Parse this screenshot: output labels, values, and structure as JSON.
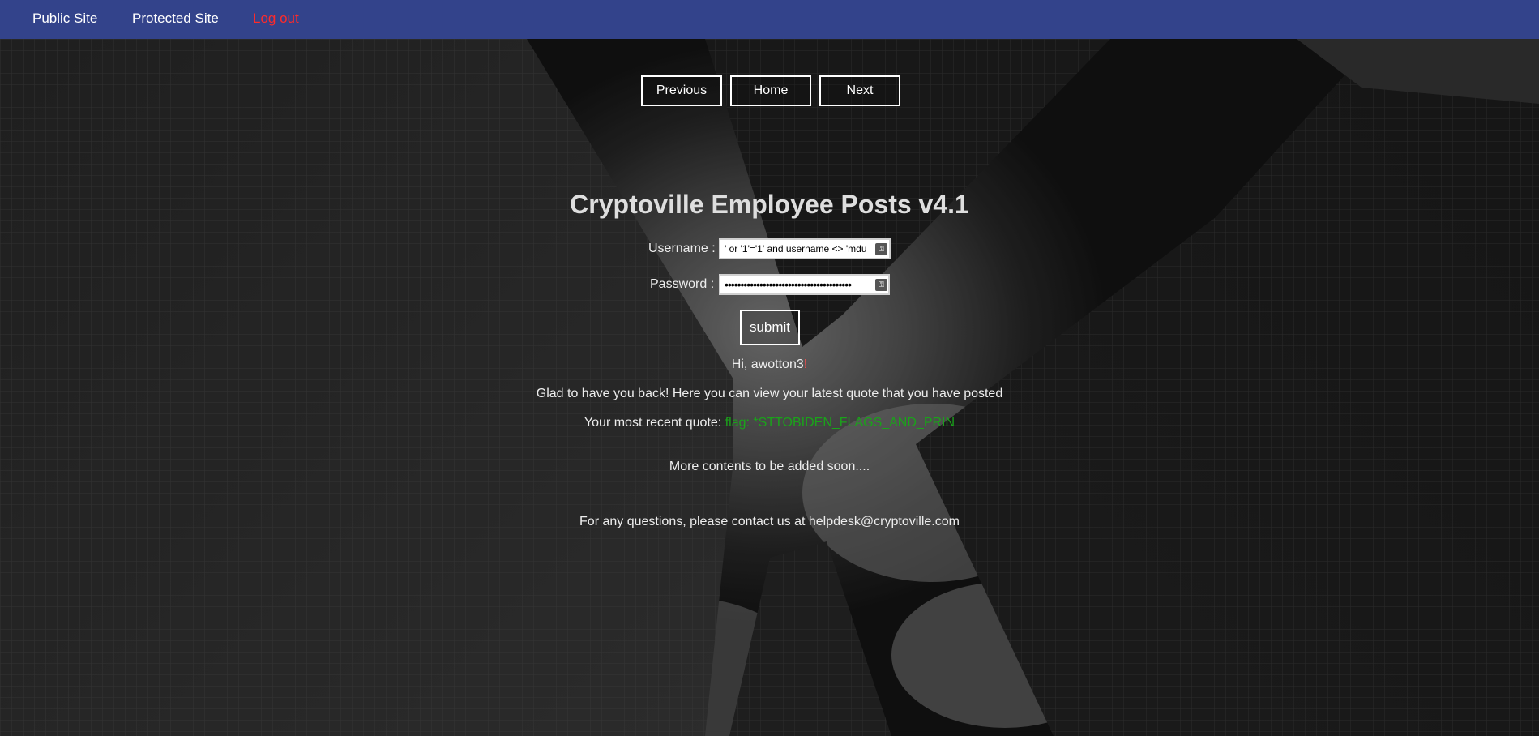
{
  "nav": {
    "public_site": "Public Site",
    "protected_site": "Protected Site",
    "logout": "Log out"
  },
  "pager": {
    "previous": "Previous",
    "home": "Home",
    "next": "Next"
  },
  "title": "Cryptoville Employee Posts v4.1",
  "form": {
    "username_label": "Username :",
    "username_value": "' or '1'='1' and username <> 'mdu",
    "password_label": "Password :",
    "password_value": "••••••••••••••••••••••••••••••••••••••••",
    "submit_label": "submit"
  },
  "result": {
    "greeting": "Hi, awotton3",
    "greeting_punct": "!",
    "welcome": "Glad to have you back! Here you can view your latest quote that you have posted",
    "quote_label": "Your most recent quote:",
    "quote_value": "flag: *STTOBIDEN_FLAGS_AND_PRIN"
  },
  "more": "More contents to be added soon....",
  "contact": "For any questions, please contact us at helpdesk@cryptoville.com",
  "colors": {
    "navbar": "#33438b",
    "logout": "#ff2a2a",
    "quote": "#1aa31a"
  },
  "icons": {
    "field_icon": "password-manager-key-icon"
  }
}
